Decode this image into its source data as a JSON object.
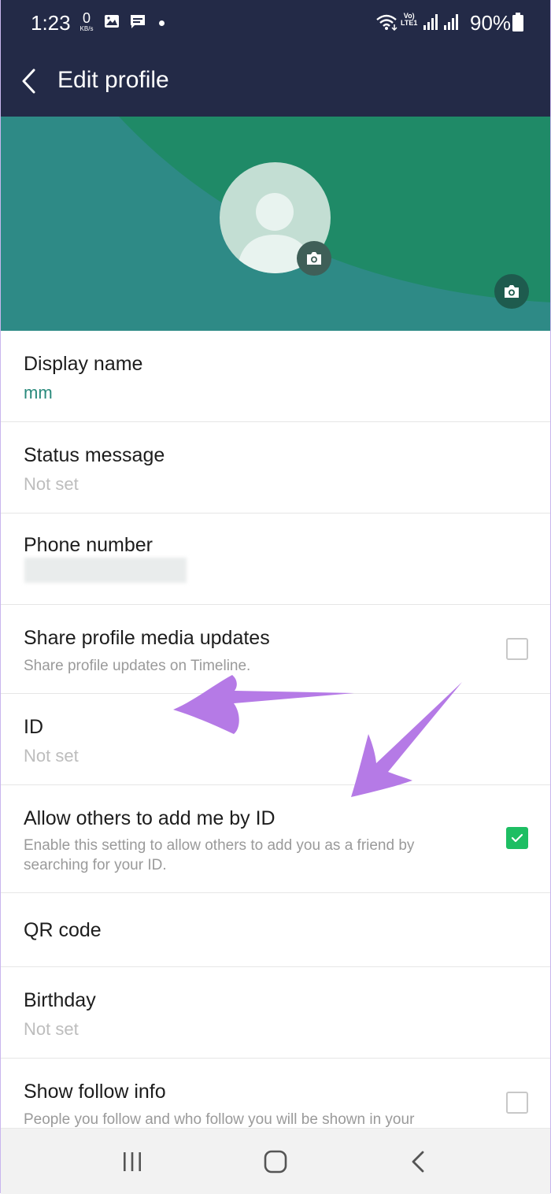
{
  "status_bar": {
    "time": "1:23",
    "net_speed_value": "0",
    "net_speed_unit": "KB/s",
    "volte_line1": "Vo)",
    "volte_line2": "LTE1",
    "battery_percent": "90%"
  },
  "app_bar": {
    "title": "Edit profile"
  },
  "profile": {
    "display_name_label": "Display name",
    "display_name_value": "mm",
    "status_label": "Status message",
    "status_value": "Not set",
    "phone_label": "Phone number",
    "share_label": "Share profile media updates",
    "share_desc": "Share profile updates on Timeline.",
    "share_checked": false,
    "id_label": "ID",
    "id_value": "Not set",
    "allow_label": "Allow others to add me by ID",
    "allow_desc": "Enable this setting to allow others to add you as a friend by searching for your ID.",
    "allow_checked": true,
    "qr_label": "QR code",
    "birthday_label": "Birthday",
    "birthday_value": "Not set",
    "follow_label": "Show follow info",
    "follow_desc": "People you follow and who follow you will be shown in your",
    "follow_checked": false
  },
  "colors": {
    "app_bar": "#232a47",
    "banner_teal": "#2e8a86",
    "banner_green": "#1f8a67",
    "accent": "#2a8a7c",
    "checkbox_on": "#1ebe63",
    "annotation_arrow": "#b57ae6"
  },
  "icons": {
    "back": "chevron-left-icon",
    "avatar_camera": "camera-icon",
    "cover_camera": "camera-icon",
    "nav_recents": "recents-icon",
    "nav_home": "home-icon",
    "nav_back": "back-icon"
  }
}
